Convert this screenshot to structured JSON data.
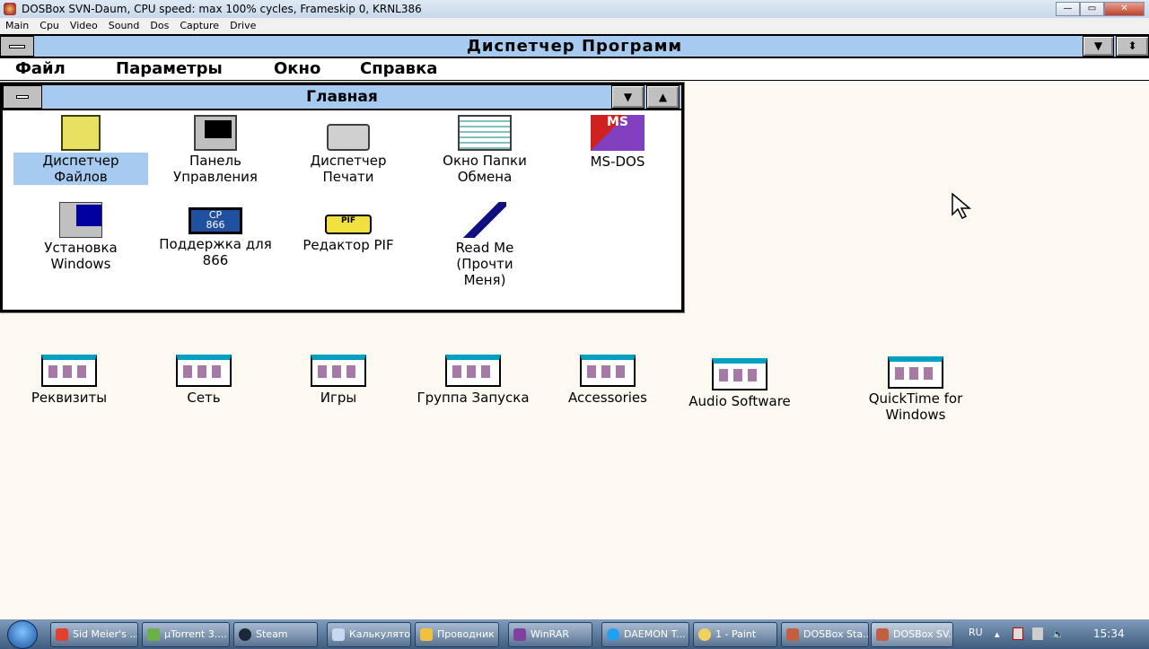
{
  "window": {
    "title": "DOSBox SVN-Daum, CPU speed: max 100% cycles, Frameskip  0,  KRNL386",
    "controls": {
      "minimize": "—",
      "maximize": "▭",
      "close": "✕"
    }
  },
  "dos_menu": [
    "Main",
    "Cpu",
    "Video",
    "Sound",
    "Dos",
    "Capture",
    "Drive"
  ],
  "progman": {
    "title": "Диспетчер Программ",
    "menu": [
      "Файл",
      "Параметры",
      "Окно",
      "Справка"
    ]
  },
  "group": {
    "title": "Главная",
    "icons": [
      {
        "label": "Диспетчер Файлов",
        "selected": true,
        "icon": "file-cabinet-icon"
      },
      {
        "label": "Панель Управления",
        "icon": "control-panel-icon"
      },
      {
        "label": "Диспетчер Печати",
        "icon": "printer-icon"
      },
      {
        "label": "Окно Папки Обмена",
        "icon": "clipboard-icon"
      },
      {
        "label": "MS-DOS",
        "icon": "msdos-icon"
      },
      {
        "label": "Установка Windows",
        "icon": "setup-icon"
      },
      {
        "label": "Поддержка для 866",
        "icon": "cp866-icon"
      },
      {
        "label": "Редактор PIF",
        "icon": "pif-icon"
      },
      {
        "label": "Read Me (Прочти Меня)",
        "icon": "readme-icon"
      }
    ]
  },
  "group_icons": [
    "Реквизиты",
    "Сеть",
    "Игры",
    "Группа Запуска",
    "Accessories",
    "Audio Software",
    "QuickTime for Windows"
  ],
  "taskbar": {
    "items": [
      "Sid Meier's ...",
      "µTorrent 3....",
      "Steam",
      "Калькулятор",
      "Проводник",
      "WinRAR",
      "DAEMON T...",
      "1 - Paint",
      "DOSBox Sta...",
      "DOSBox SV..."
    ],
    "lang": "RU",
    "clock": "15:34"
  }
}
